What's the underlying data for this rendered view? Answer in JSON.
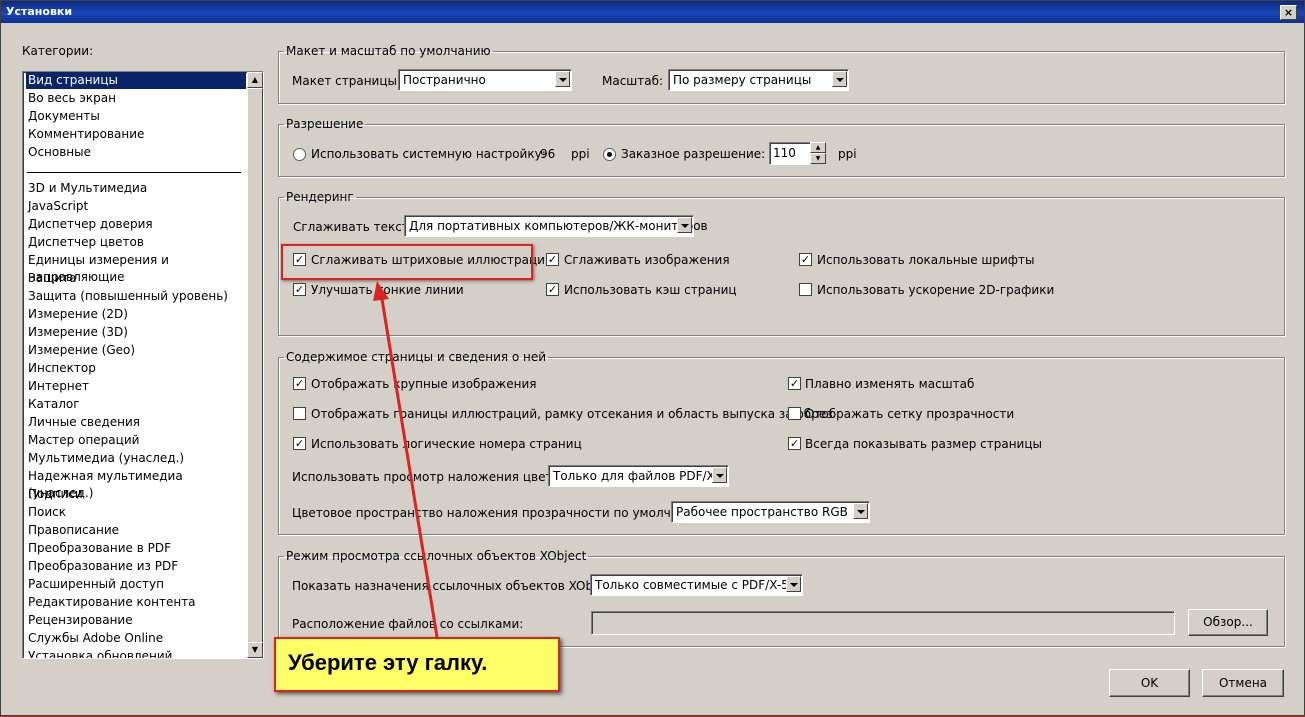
{
  "window": {
    "title": "Установки",
    "close_glyph": "×"
  },
  "categories": {
    "label": "Категории:",
    "group1": [
      "Вид страницы",
      "Во весь экран",
      "Документы",
      "Комментирование",
      "Основные"
    ],
    "group2": [
      "3D и Мультимедиа",
      "JavaScript",
      "Диспетчер доверия",
      "Диспетчер цветов",
      "Единицы измерения и направляющие",
      "Защита",
      "Защита (повышенный уровень)",
      "Измерение (2D)",
      "Измерение (3D)",
      "Измерение (Geo)",
      "Инспектор",
      "Интернет",
      "Каталог",
      "Личные сведения",
      "Мастер операций",
      "Мультимедиа (унаслед.)",
      "Надежная мультимедиа (унаслед.)",
      "Подписи",
      "Поиск",
      "Правописание",
      "Преобразование в PDF",
      "Преобразование из PDF",
      "Расширенный доступ",
      "Редактирование контента",
      "Рецензирование",
      "Службы Adobe Online",
      "Установка обновлений"
    ],
    "selected": "Вид страницы"
  },
  "layout": {
    "legend": "Макет и масштаб по умолчанию",
    "page_layout_label": "Макет страницы:",
    "page_layout_value": "Постранично",
    "zoom_label": "Масштаб:",
    "zoom_value": "По размеру страницы"
  },
  "resolution": {
    "legend": "Разрешение",
    "system_label": "Использовать системную настройку:",
    "system_value": "96",
    "ppi": "ppi",
    "custom_label": "Заказное разрешение:",
    "custom_value": "110",
    "selected": "custom"
  },
  "rendering": {
    "legend": "Рендеринг",
    "smooth_text_label": "Сглаживать текст:",
    "smooth_text_value": "Для портативных компьютеров/ЖК-мониторов",
    "checkboxes": [
      {
        "label": "Сглаживать штриховые иллюстрации",
        "checked": true
      },
      {
        "label": "Сглаживать изображения",
        "checked": true
      },
      {
        "label": "Использовать локальные шрифты",
        "checked": true
      },
      {
        "label": "Улучшать тонкие линии",
        "checked": true
      },
      {
        "label": "Использовать кэш страниц",
        "checked": true
      },
      {
        "label": "Использовать ускорение 2D-графики",
        "checked": false
      }
    ]
  },
  "content": {
    "legend": "Содержимое страницы и сведения о ней",
    "checkboxes": [
      {
        "label": "Отображать крупные изображения",
        "checked": true
      },
      {
        "label": "Плавно изменять масштаб",
        "checked": true
      },
      {
        "label": "Отображать границы иллюстраций, рамку отсекания и область выпуска за обрез",
        "checked": false
      },
      {
        "label": "Отображать сетку прозрачности",
        "checked": false
      },
      {
        "label": "Использовать логические номера страниц",
        "checked": true
      },
      {
        "label": "Всегда показывать размер страницы",
        "checked": true
      }
    ],
    "overprint_label": "Использовать просмотр наложения цветов:",
    "overprint_value": "Только для файлов PDF/X",
    "blend_label": "Цветовое пространство наложения прозрачности по умолчанию:",
    "blend_value": "Рабочее пространство RGB"
  },
  "xobject": {
    "legend": "Режим просмотра ссылочных объектов XObject",
    "show_label": "Показать назначения ссылочных объектов XObject:",
    "show_value": "Только совместимые с PDF/X-5",
    "location_label": "Расположение файлов со ссылками:",
    "browse": "Обзор..."
  },
  "buttons": {
    "ok": "OK",
    "cancel": "Отмена"
  },
  "callout": {
    "text": "Уберите эту галку."
  },
  "colors": {
    "highlight": "#dd2222",
    "callout_bg": "#ffff66",
    "selection": "#0a246a"
  }
}
